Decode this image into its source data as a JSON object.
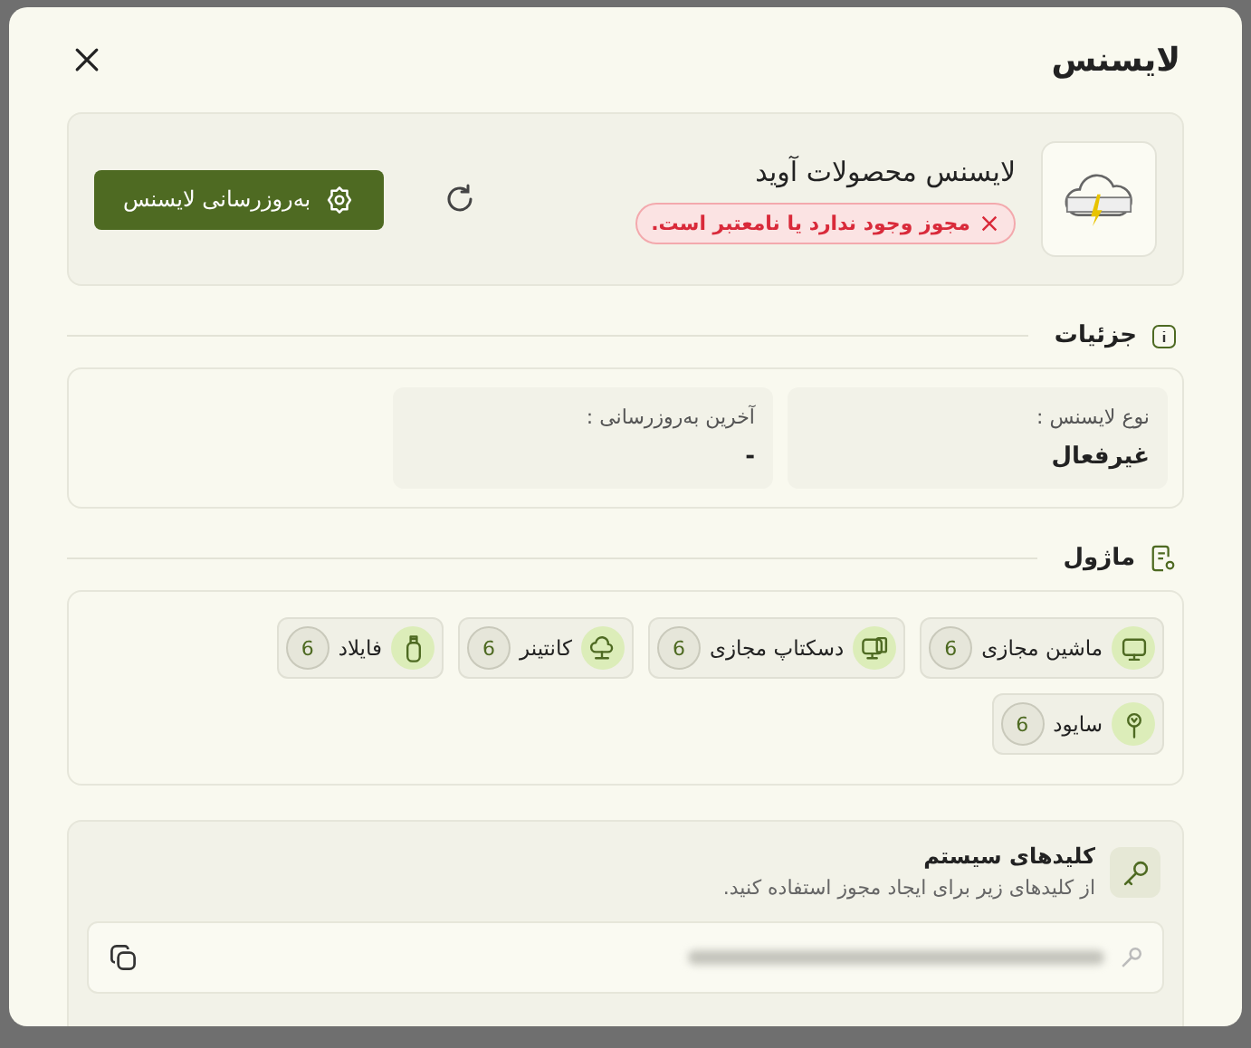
{
  "dialog": {
    "title": "لایسنس"
  },
  "license": {
    "product": "لایسنس محصولات آوید",
    "status": {
      "kind": "error",
      "text": "مجوز وجود ندارد یا نامعتبر است."
    },
    "update_button": "به‌روزرسانی لایسنس"
  },
  "details": {
    "title": "جزئیات",
    "fields": [
      {
        "label": "نوع لایسنس :",
        "value": "غیرفعال"
      },
      {
        "label": "آخرین به‌روزرسانی :",
        "value": "-"
      }
    ]
  },
  "modules": {
    "title": "ماژول",
    "items": [
      {
        "name": "ماشین مجازی",
        "count": "6"
      },
      {
        "name": "دسکتاپ مجازی",
        "count": "6"
      },
      {
        "name": "کانتینر",
        "count": "6"
      },
      {
        "name": "فایلاد",
        "count": "6"
      },
      {
        "name": "سایود",
        "count": "6"
      }
    ]
  },
  "keys": {
    "title": "کلیدهای سیستم",
    "subtitle": "از کلیدهای زیر برای ایجاد مجوز استفاده کنید."
  }
}
